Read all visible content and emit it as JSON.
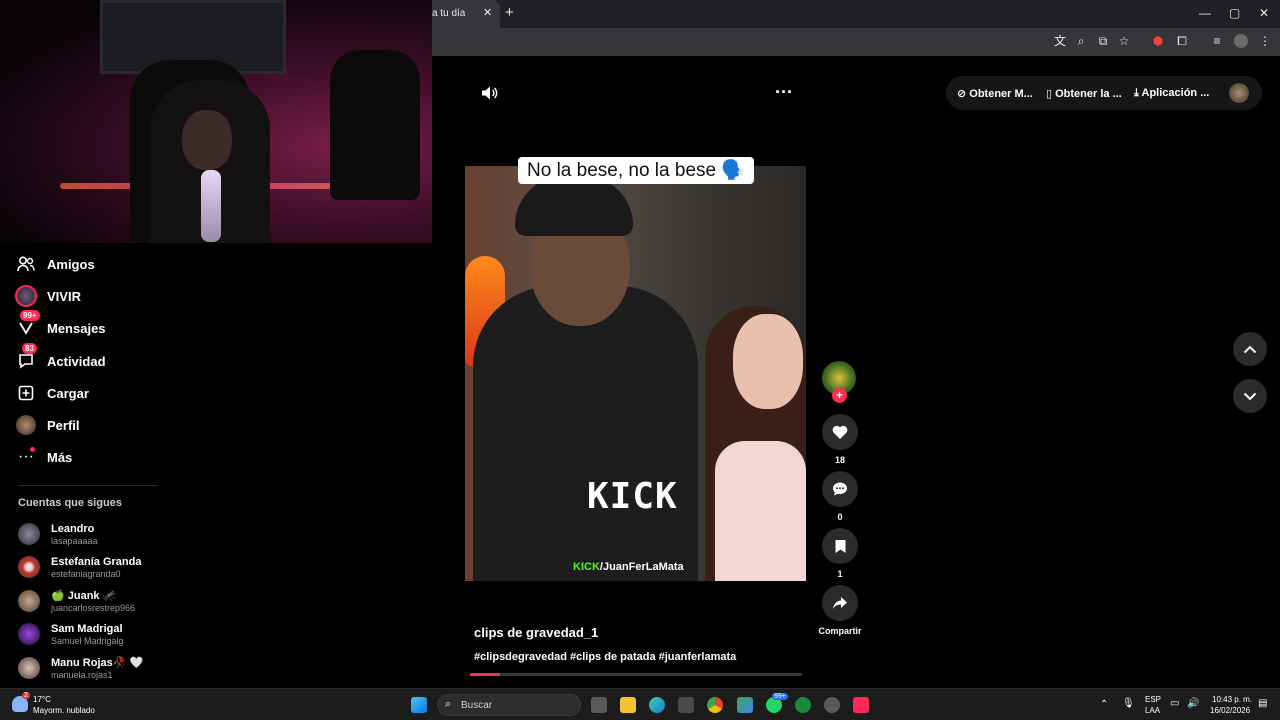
{
  "browser": {
    "tab_title": "a tu día",
    "tab_close": "✕",
    "new_tab": "+",
    "window_controls": [
      "—",
      "▢",
      "✕"
    ],
    "toolbar_icons": [
      "translate-icon",
      "zoom-icon",
      "cast-icon",
      "star-icon",
      "extension-red-icon",
      "puzzle-icon",
      "media-icon",
      "profile-icon",
      "menu-icon"
    ]
  },
  "sidebar": {
    "items": [
      {
        "label": "Amigos",
        "icon": "friends-icon"
      },
      {
        "label": "VIVIR",
        "icon": "live-icon"
      },
      {
        "label": "Mensajes",
        "icon": "messages-icon",
        "badge": "99+"
      },
      {
        "label": "Actividad",
        "icon": "activity-icon",
        "badge": "83"
      },
      {
        "label": "Cargar",
        "icon": "upload-icon"
      },
      {
        "label": "Perfil",
        "icon": "profile-icon"
      },
      {
        "label": "Más",
        "icon": "more-icon"
      }
    ],
    "following_title": "Cuentas que sigues",
    "following": [
      {
        "name": "Leandro",
        "user": "lasapaaaaa"
      },
      {
        "name": "Estefanía Granda",
        "user": "estefaniagranda0"
      },
      {
        "name": "🍏 Juank 🦟",
        "user": "juancarlosrestrep966"
      },
      {
        "name": "Sam Madrigal",
        "user": "Samuel Madrigalg"
      },
      {
        "name": "Manu Rojas🥀 🤍",
        "user": "manuela.rojas1"
      }
    ]
  },
  "header": {
    "pill": [
      "Obtener M...",
      "Obtener la ...",
      "Aplicación ..."
    ]
  },
  "video": {
    "caption": "No la bese, no la bese 🗣️",
    "overlay_logo": "KICK",
    "overlay_tag_brand": "KICK",
    "overlay_tag_channel": "/JuanFerLaMata",
    "title": "clips de gravedad_1",
    "hashtags": "#clipsdegravedad #clips de patada #juanferlamata",
    "progress": 0.09
  },
  "actions": {
    "likes": "18",
    "comments": "0",
    "saves": "1",
    "share_label": "Compartir"
  },
  "taskbar": {
    "weather_temp": "17°C",
    "weather_desc": "Mayorm. nublado",
    "weather_badge": "2",
    "search_placeholder": "Buscar",
    "whatsapp_badge": "99+",
    "lang_top": "ESP",
    "lang_bottom": "LAA",
    "time": "10:43 p. m.",
    "date": "16/02/2026"
  },
  "colors": {
    "accent": "#fe2c55",
    "kick_green": "#53fc18",
    "chrome_bg": "#202124"
  }
}
